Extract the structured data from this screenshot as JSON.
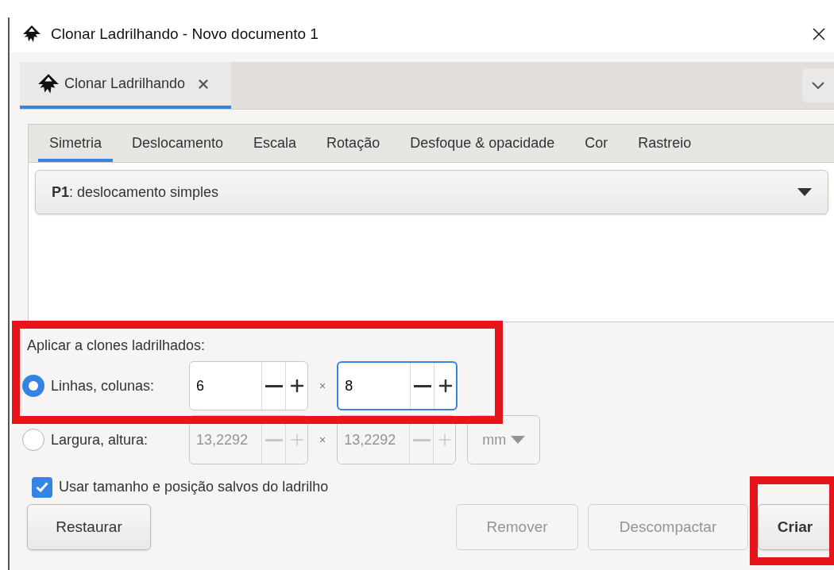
{
  "window": {
    "title": "Clonar Ladrilhando - Novo documento 1"
  },
  "dock_tab": {
    "label": "Clonar Ladrilhando",
    "selected": true
  },
  "tabs": [
    {
      "label": "Simetria",
      "selected": true
    },
    {
      "label": "Deslocamento",
      "selected": false
    },
    {
      "label": "Escala",
      "selected": false
    },
    {
      "label": "Rotação",
      "selected": false
    },
    {
      "label": "Desfoque & opacidade",
      "selected": false
    },
    {
      "label": "Cor",
      "selected": false
    },
    {
      "label": "Rastreio",
      "selected": false
    }
  ],
  "symmetry_select": {
    "value": "**P1**: deslocamento simples"
  },
  "apply": {
    "label": "Aplicar a clones ladrilhados:",
    "highlighted": true,
    "modes": [
      {
        "label": "Linhas, colunas:",
        "selected": true,
        "separator": "×",
        "fields": [
          {
            "value": "6",
            "focused": false
          },
          {
            "value": "8",
            "focused": true
          }
        ]
      },
      {
        "label": "Largura, altura:",
        "selected": false,
        "separator": "×",
        "fields": [
          {
            "value": "13,2292",
            "focused": false
          },
          {
            "value": "13,2292",
            "focused": false
          }
        ],
        "unit": "mm"
      }
    ]
  },
  "checkbox": {
    "label": "Usar tamanho e posição salvos do ladrilho",
    "checked": true
  },
  "buttons": [
    {
      "label": "Restaurar",
      "kind": "left",
      "disabled": false,
      "default": false,
      "highlighted": false
    },
    {
      "label": "Remover",
      "kind": "right",
      "disabled": true,
      "default": false,
      "highlighted": false
    },
    {
      "label": "Descompactar",
      "kind": "right",
      "disabled": true,
      "default": false,
      "highlighted": false
    },
    {
      "label": "Criar",
      "kind": "right",
      "disabled": false,
      "default": true,
      "highlighted": true
    }
  ]
}
